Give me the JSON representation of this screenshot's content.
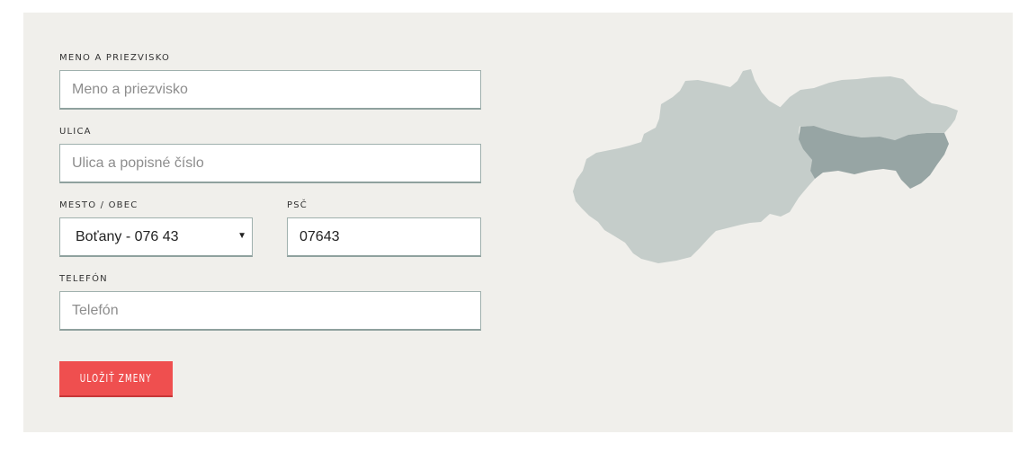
{
  "form": {
    "name_label": "MENO A PRIEZVISKO",
    "name_placeholder": "Meno a priezvisko",
    "street_label": "ULICA",
    "street_placeholder": "Ulica a popisné číslo",
    "city_label": "MESTO / OBEC",
    "city_value": "Boťany - 076 43",
    "psc_label": "PSČ",
    "psc_value": "07643",
    "phone_label": "TELEFÓN",
    "phone_placeholder": "Telefón",
    "submit_label": "ULOŽIŤ ZMENY"
  },
  "map": {
    "highlighted_region": "east-lower",
    "colors": {
      "base": "#c5cdca",
      "highlight": "#97a5a4"
    }
  },
  "colors": {
    "panel_bg": "#f0efeb",
    "accent": "#ef4f4f"
  }
}
